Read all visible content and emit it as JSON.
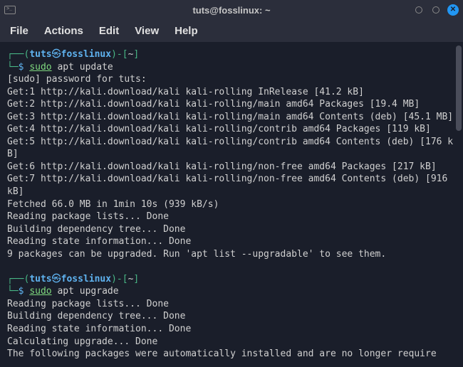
{
  "titlebar": {
    "title": "tuts@fosslinux: ~"
  },
  "menubar": {
    "file": "File",
    "actions": "Actions",
    "edit": "Edit",
    "view": "View",
    "help": "Help"
  },
  "prompt": {
    "user": "tuts",
    "sym": "㉿",
    "host": "fosslinux",
    "path": "~",
    "dollar": "$"
  },
  "commands": {
    "cmd1_sudo": "sudo",
    "cmd1_rest": " apt update",
    "cmd2_sudo": "sudo",
    "cmd2_rest": " apt upgrade"
  },
  "output": {
    "block1": "[sudo] password for tuts:\nGet:1 http://kali.download/kali kali-rolling InRelease [41.2 kB]\nGet:2 http://kali.download/kali kali-rolling/main amd64 Packages [19.4 MB]\nGet:3 http://kali.download/kali kali-rolling/main amd64 Contents (deb) [45.1 MB]\nGet:4 http://kali.download/kali kali-rolling/contrib amd64 Packages [119 kB]\nGet:5 http://kali.download/kali kali-rolling/contrib amd64 Contents (deb) [176 kB]\nGet:6 http://kali.download/kali kali-rolling/non-free amd64 Packages [217 kB]\nGet:7 http://kali.download/kali kali-rolling/non-free amd64 Contents (deb) [916 kB]\nFetched 66.0 MB in 1min 10s (939 kB/s)\nReading package lists... Done\nBuilding dependency tree... Done\nReading state information... Done\n9 packages can be upgraded. Run 'apt list --upgradable' to see them.",
    "block2": "Reading package lists... Done\nBuilding dependency tree... Done\nReading state information... Done\nCalculating upgrade... Done\nThe following packages were automatically installed and are no longer require"
  }
}
